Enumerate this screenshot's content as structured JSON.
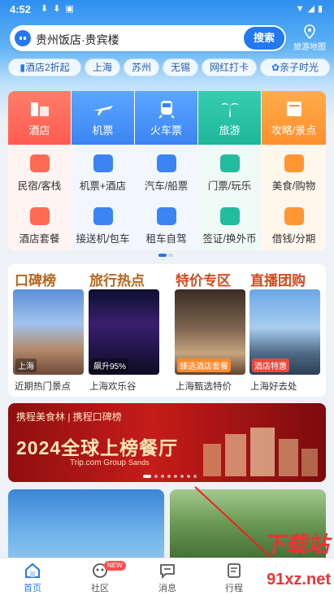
{
  "status_bar": {
    "time": "4:52"
  },
  "search": {
    "query": "贵州饭店·贵宾楼",
    "button_label": "搜索",
    "map_label": "旅游地图"
  },
  "chips": [
    "酒店2折起",
    "上海",
    "苏州",
    "无锡",
    "网红打卡",
    "亲子时光"
  ],
  "main_tiles": [
    {
      "label": "酒店",
      "icon": "hotel-icon"
    },
    {
      "label": "机票",
      "icon": "plane-icon"
    },
    {
      "label": "火车票",
      "icon": "train-icon"
    },
    {
      "label": "旅游",
      "icon": "palm-tree-icon"
    },
    {
      "label": "攻略/景点",
      "icon": "guide-book-icon"
    }
  ],
  "sub_row1": [
    {
      "label": "民宿/客栈",
      "icon": "homestay-icon"
    },
    {
      "label": "机票+酒店",
      "icon": "flight-hotel-icon"
    },
    {
      "label": "汽车/船票",
      "icon": "bus-icon"
    },
    {
      "label": "门票/玩乐",
      "icon": "ticket-icon"
    },
    {
      "label": "美食/购物",
      "icon": "shopping-bag-icon"
    }
  ],
  "sub_row2": [
    {
      "label": "酒店套餐",
      "icon": "hotel-package-icon"
    },
    {
      "label": "接送机/包车",
      "icon": "airport-transfer-icon"
    },
    {
      "label": "租车自驾",
      "icon": "car-icon"
    },
    {
      "label": "签证/换外币",
      "icon": "visa-icon"
    },
    {
      "label": "借钱/分期",
      "icon": "money-bag-icon"
    }
  ],
  "promo": {
    "headers": [
      "口碑榜",
      "旅行热点",
      "特价专区",
      "直播团购"
    ],
    "items": [
      {
        "caption": "近期热门景点",
        "tag": "上海"
      },
      {
        "caption": "上海欢乐谷",
        "tag": "飙升95%"
      },
      {
        "caption": "上海甄选特价",
        "tag": "臻选酒店套餐"
      },
      {
        "caption": "上海好去处",
        "tag": "酒店特惠"
      }
    ]
  },
  "banner": {
    "top_text": "携程美食林 | 携程口碑榜",
    "title": "2024全球上榜餐厅",
    "sponsor": "Trip.com Group",
    "partner": "Sands"
  },
  "tabs": [
    {
      "label": "首页",
      "icon": "home-icon",
      "active": true
    },
    {
      "label": "社区",
      "icon": "community-icon",
      "active": false
    },
    {
      "label": "消息",
      "icon": "message-icon",
      "active": false
    },
    {
      "label": "行程",
      "icon": "itinerary-icon",
      "active": false
    }
  ],
  "badge_new": "NEW",
  "watermark": {
    "line1": "下载站",
    "line2": "91xz.net"
  },
  "colors": {
    "accent": "#2478f0",
    "promo_heading": "#b9651d"
  }
}
